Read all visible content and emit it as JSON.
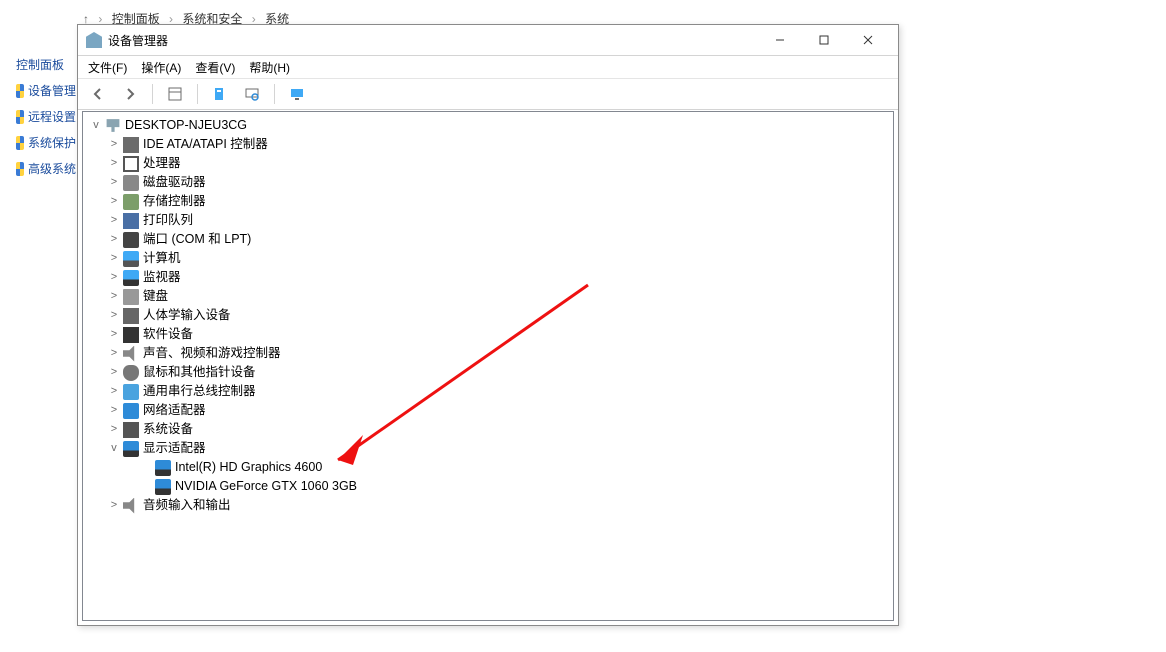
{
  "breadcrumb": {
    "seg1": "控制面板",
    "seg2": "系统和安全",
    "seg3": "系统"
  },
  "side": {
    "item1": "控制面板",
    "item2": "设备管理",
    "item3": "远程设置",
    "item4": "系统保护",
    "item5": "高级系统"
  },
  "window": {
    "title": "设备管理器"
  },
  "menu": {
    "file": "文件(F)",
    "action": "操作(A)",
    "view": "查看(V)",
    "help": "帮助(H)"
  },
  "tree": {
    "root": "DESKTOP-NJEU3CG",
    "items": [
      {
        "label": "IDE ATA/ATAPI 控制器",
        "exp": ">",
        "kind": "i-ide"
      },
      {
        "label": "处理器",
        "exp": ">",
        "kind": "i-cpu"
      },
      {
        "label": "磁盘驱动器",
        "exp": ">",
        "kind": "i-disk"
      },
      {
        "label": "存储控制器",
        "exp": ">",
        "kind": "i-stor"
      },
      {
        "label": "打印队列",
        "exp": ">",
        "kind": "i-prn"
      },
      {
        "label": "端口 (COM 和 LPT)",
        "exp": ">",
        "kind": "i-port"
      },
      {
        "label": "计算机",
        "exp": ">",
        "kind": "i-comp"
      },
      {
        "label": "监视器",
        "exp": ">",
        "kind": "i-mon"
      },
      {
        "label": "键盘",
        "exp": ">",
        "kind": "i-kb"
      },
      {
        "label": "人体学输入设备",
        "exp": ">",
        "kind": "i-hid"
      },
      {
        "label": "软件设备",
        "exp": ">",
        "kind": "i-sw"
      },
      {
        "label": "声音、视频和游戏控制器",
        "exp": ">",
        "kind": "i-snd"
      },
      {
        "label": "鼠标和其他指针设备",
        "exp": ">",
        "kind": "i-mouse"
      },
      {
        "label": "通用串行总线控制器",
        "exp": ">",
        "kind": "i-usb"
      },
      {
        "label": "网络适配器",
        "exp": ">",
        "kind": "i-net"
      },
      {
        "label": "系统设备",
        "exp": ">",
        "kind": "i-sys"
      },
      {
        "label": "显示适配器",
        "exp": "v",
        "kind": "i-gpu",
        "children": [
          {
            "label": "Intel(R) HD Graphics 4600",
            "kind": "i-gpu"
          },
          {
            "label": "NVIDIA GeForce GTX 1060 3GB",
            "kind": "i-gpu"
          }
        ]
      },
      {
        "label": "音频输入和输出",
        "exp": ">",
        "kind": "i-aud"
      }
    ]
  }
}
